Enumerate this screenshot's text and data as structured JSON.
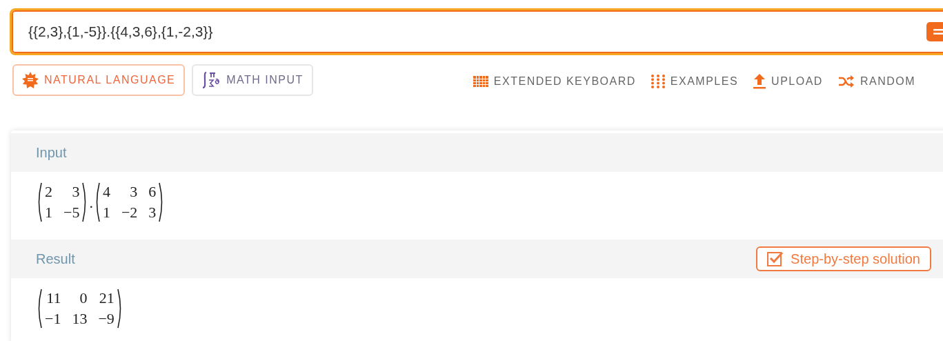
{
  "query": {
    "value": "{{2,3},{1,-5}}.{{4,3,6},{1,-2,3}}"
  },
  "modes": [
    {
      "kind": "natural",
      "label": "NATURAL LANGUAGE",
      "selected": true
    },
    {
      "kind": "math",
      "label": "MATH INPUT",
      "selected": false
    }
  ],
  "tools": [
    {
      "kind": "keyboard",
      "label": "EXTENDED KEYBOARD"
    },
    {
      "kind": "examples",
      "label": "EXAMPLES"
    },
    {
      "kind": "upload",
      "label": "UPLOAD"
    },
    {
      "kind": "random",
      "label": "RANDOM"
    }
  ],
  "pods": [
    {
      "title": "Input",
      "expression": [
        {
          "kind": "matrix",
          "rows": [
            [
              "2",
              "3"
            ],
            [
              "1",
              "−5"
            ]
          ]
        },
        {
          "kind": "operator",
          "text": "."
        },
        {
          "kind": "matrix",
          "rows": [
            [
              "4",
              "3",
              "6"
            ],
            [
              "1",
              "−2",
              "3"
            ]
          ]
        }
      ]
    },
    {
      "title": "Result",
      "step_button": "Step-by-step solution",
      "expression": [
        {
          "kind": "matrix",
          "rows": [
            [
              "11",
              "0",
              "21"
            ],
            [
              "−1",
              "13",
              "−9"
            ]
          ]
        }
      ]
    }
  ]
}
